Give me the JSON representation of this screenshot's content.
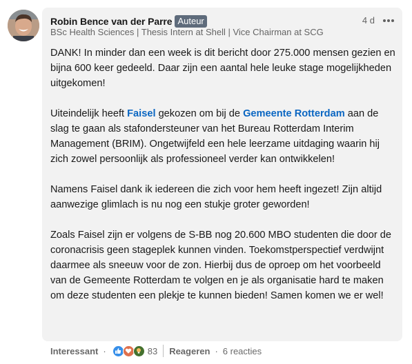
{
  "comment": {
    "author": "Robin Bence van der Parre",
    "badge": "Auteur",
    "headline": "BSc Health Sciences | Thesis Intern at Shell | Vice Chairman at SCG",
    "time": "4 d",
    "paragraphs": {
      "p1": "DANK! In minder dan een week is dit bericht door 275.000 mensen gezien en bijna 600 keer gedeeld. Daar zijn een aantal hele leuke stage mogelijkheden uitgekomen!",
      "p2_a": "Uiteindelijk heeft ",
      "p2_mention1": "Faisel",
      "p2_b": " gekozen om bij de ",
      "p2_mention2": "Gemeente Rotterdam",
      "p2_c": " aan de slag te gaan als stafondersteuner van het Bureau Rotterdam Interim Management (BRIM). Ongetwijfeld een hele leerzame uitdaging waarin hij zich zowel persoonlijk als professioneel verder kan ontwikkelen!",
      "p3": "Namens Faisel dank ik iedereen die zich voor hem heeft ingezet! Zijn altijd aanwezige glimlach is nu nog een stukje groter geworden!",
      "p4": "Zoals Faisel zijn er volgens de S-BB nog 20.600 MBO studenten die door de coronacrisis geen stageplek kunnen vinden. Toekomstperspectief verdwijnt daarmee als sneeuw voor de zon. Hierbij dus de oproep om het voorbeeld van de Gemeente Rotterdam te volgen en je als organisatie hard te maken om deze studenten een plekje te kunnen bieden! Samen komen we er wel!"
    }
  },
  "actions": {
    "react_label": "Interessant",
    "reaction_count": "83",
    "reply_label": "Reageren",
    "replies": "6 reacties",
    "separator": "·"
  },
  "colors": {
    "like": "#378fe9",
    "love": "#df704d",
    "insightful": "#44712e",
    "mention": "#0a66c2",
    "badge": "#5e6b7b"
  },
  "icons": [
    "like-icon",
    "love-icon",
    "insightful-icon",
    "more-options-icon",
    "avatar"
  ]
}
